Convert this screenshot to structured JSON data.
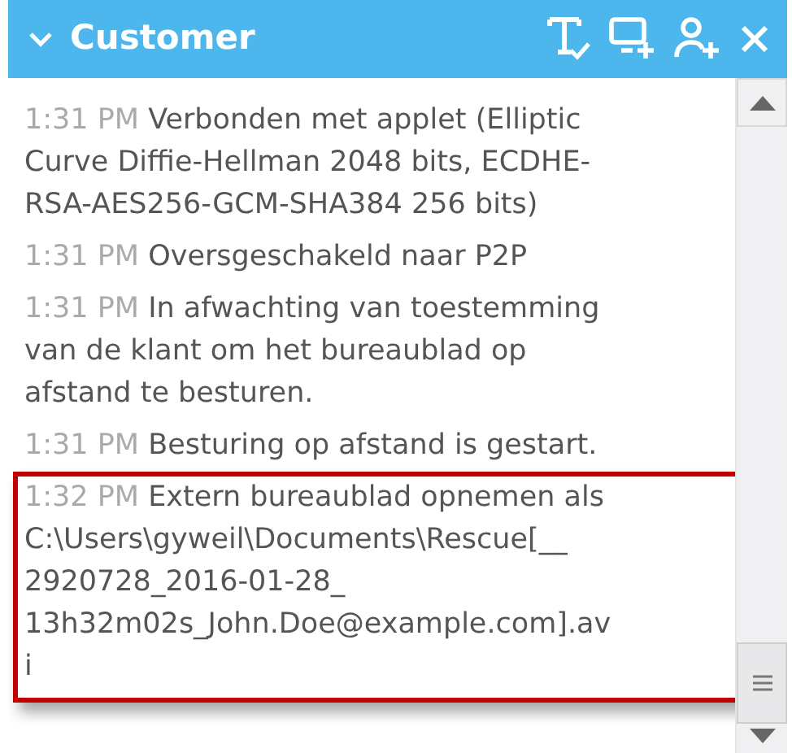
{
  "panel": {
    "title": "Customer",
    "expanded": true
  },
  "messages": [
    {
      "time": "1:31 PM",
      "lines": [
        "Verbonden met applet (Elliptic",
        "Curve Diffie-Hellman 2048 bits, ECDHE-",
        "RSA-AES256-GCM-SHA384 256 bits)"
      ],
      "selected": false
    },
    {
      "time": "1:31 PM",
      "lines": [
        "Oversgeschakeld naar P2P"
      ],
      "selected": false
    },
    {
      "time": "1:31 PM",
      "lines": [
        "In afwachting van toestemming",
        "van de klant om het bureaublad op",
        "afstand te besturen."
      ],
      "selected": false
    },
    {
      "time": "1:31 PM",
      "lines": [
        "Besturing op afstand is gestart."
      ],
      "selected": false
    },
    {
      "time": "1:32 PM",
      "lines": [
        "Extern bureaublad opnemen als",
        "C:\\Users\\gyweil\\Documents\\Rescue[__",
        "2920728_2016-01-28_",
        "13h32m02s_John.Doe@example.com].av",
        "i"
      ],
      "selected": true
    }
  ]
}
